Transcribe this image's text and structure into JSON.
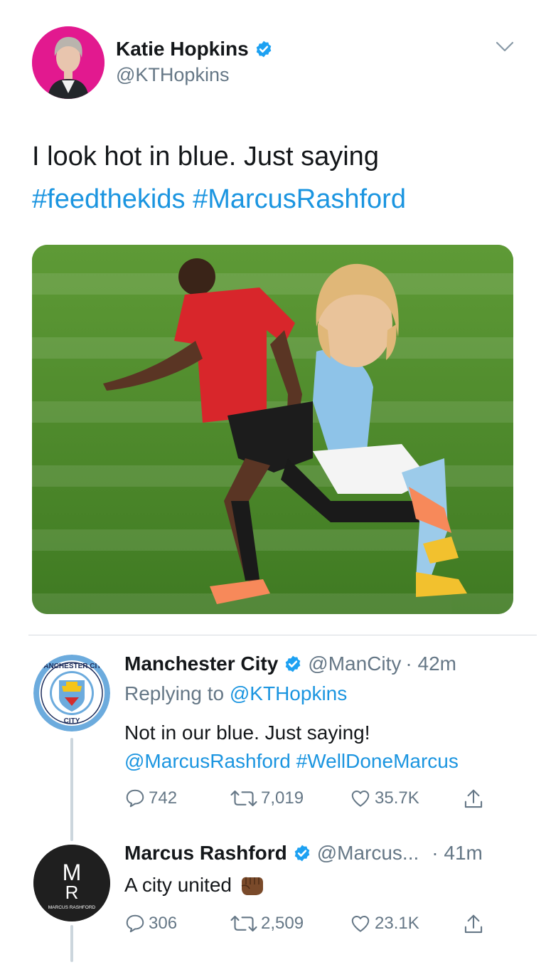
{
  "main_tweet": {
    "author_name": "Katie Hopkins",
    "author_handle": "@KTHopkins",
    "text_line1": "I look hot in blue. Just saying",
    "hashtag1": "#feedthekids",
    "hashtag2": "#MarcusRashford",
    "photo_desc": "photo"
  },
  "replies": [
    {
      "author_name": "Manchester City",
      "author_handle": "@ManCity",
      "time": "· 42m",
      "replying_prefix": "Replying to ",
      "replying_to": "@KTHopkins",
      "text": "Not in our blue. Just saying!",
      "mention": "@MarcusRashford",
      "hashtag": "#WellDoneMarcus",
      "reply_count": "742",
      "retweet_count": "7,019",
      "like_count": "35.7K",
      "avatar_label": "MANCHESTER CITY",
      "avatar_label_bottom": "CITY"
    },
    {
      "author_name": "Marcus Rashford",
      "author_handle": "@Marcus...",
      "time": "· 41m",
      "text": "A city united",
      "reply_count": "306",
      "retweet_count": "2,509",
      "like_count": "23.1K",
      "avatar_monogram_top": "M",
      "avatar_monogram_bottom": "R",
      "avatar_label": "MARCUS RASHFORD"
    }
  ],
  "colors": {
    "link_blue": "#1b95e0",
    "verified_blue": "#1da1f2",
    "muted_text": "#657786",
    "thread_line": "#ccd6dd",
    "city_sky_blue": "#6cabdd"
  },
  "icons": [
    "verified-badge-icon",
    "chevron-down-icon",
    "reply-icon",
    "retweet-icon",
    "like-icon",
    "share-icon",
    "fist-emoji-icon"
  ]
}
